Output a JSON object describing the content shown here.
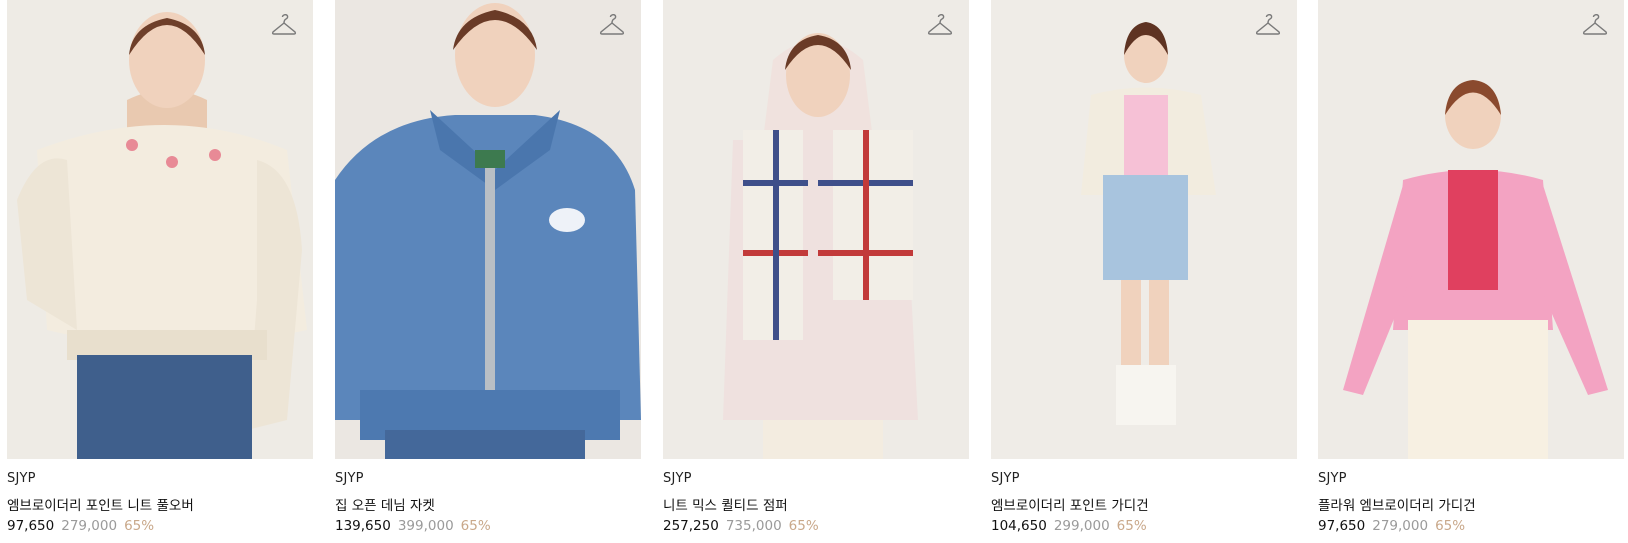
{
  "colors": {
    "original_price": "#9a9a9a",
    "discount": "#c9a88a",
    "image_background": "#eeeae4"
  },
  "products": [
    {
      "brand": "SJYP",
      "name": "엠브로이더리 포인트 니트 풀오버",
      "sale_price": "97,650",
      "original_price": "279,000",
      "discount": "65%",
      "icon": "hanger-icon"
    },
    {
      "brand": "SJYP",
      "name": "집 오픈 데님 자켓",
      "sale_price": "139,650",
      "original_price": "399,000",
      "discount": "65%",
      "icon": "hanger-icon"
    },
    {
      "brand": "SJYP",
      "name": "니트 믹스 퀼티드 점퍼",
      "sale_price": "257,250",
      "original_price": "735,000",
      "discount": "65%",
      "icon": "hanger-icon"
    },
    {
      "brand": "SJYP",
      "name": "엠브로이더리 포인트 가디건",
      "sale_price": "104,650",
      "original_price": "299,000",
      "discount": "65%",
      "icon": "hanger-icon"
    },
    {
      "brand": "SJYP",
      "name": "플라워 엠브로이더리 가디건",
      "sale_price": "97,650",
      "original_price": "279,000",
      "discount": "65%",
      "icon": "hanger-icon"
    }
  ]
}
